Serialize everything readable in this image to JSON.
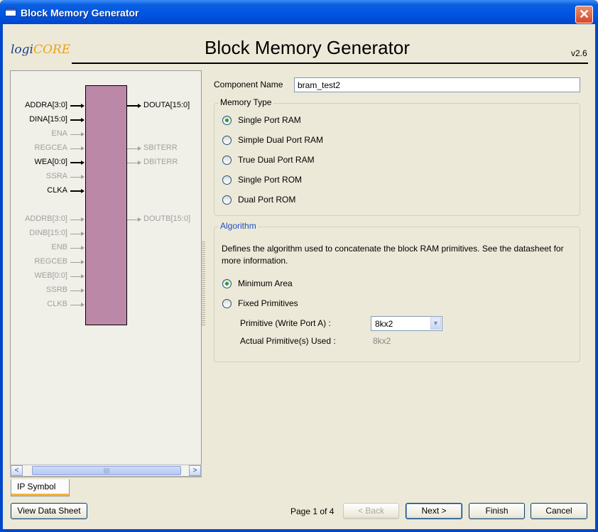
{
  "window": {
    "title": "Block Memory Generator",
    "close_symbol": "✕"
  },
  "header": {
    "logo_main": "logi",
    "logo_accent": "CORE",
    "title": "Block Memory Generator",
    "version": "v2.6"
  },
  "symbol": {
    "pins_left": [
      {
        "label": "ADDRA[3:0]",
        "active": true
      },
      {
        "label": "DINA[15:0]",
        "active": true
      },
      {
        "label": "ENA",
        "active": false
      },
      {
        "label": "REGCEA",
        "active": false
      },
      {
        "label": "WEA[0:0]",
        "active": true
      },
      {
        "label": "SSRA",
        "active": false
      },
      {
        "label": "CLKA",
        "active": true
      },
      {
        "label": "ADDRB[3:0]",
        "active": false
      },
      {
        "label": "DINB[15:0]",
        "active": false
      },
      {
        "label": "ENB",
        "active": false
      },
      {
        "label": "REGCEB",
        "active": false
      },
      {
        "label": "WEB[0:0]",
        "active": false
      },
      {
        "label": "SSRB",
        "active": false
      },
      {
        "label": "CLKB",
        "active": false
      }
    ],
    "pins_right": [
      {
        "label": "DOUTA[15:0]",
        "active": true
      },
      {
        "label": "SBITERR",
        "active": false
      },
      {
        "label": "DBITERR",
        "active": false
      },
      {
        "label": "DOUTB[15:0]",
        "active": false
      }
    ],
    "tab_label": "IP Symbol",
    "scroll_left": "<",
    "scroll_right": ">",
    "scroll_grip": "||||"
  },
  "component": {
    "label": "Component Name",
    "value": "bram_test2"
  },
  "memory_type": {
    "label": "Memory Type",
    "options": [
      "Single Port RAM",
      "Simple Dual Port RAM",
      "True Dual Port RAM",
      "Single Port ROM",
      "Dual Port ROM"
    ],
    "selected": 0
  },
  "algorithm": {
    "label": "Algorithm",
    "description": "Defines the algorithm used to concatenate the block RAM primitives.  See the datasheet for more information.",
    "options": [
      "Minimum Area",
      "Fixed Primitives"
    ],
    "selected": 0,
    "primitive_label": "Primitive (Write Port A) :",
    "primitive_value": "8kx2",
    "actual_label": "Actual Primitive(s) Used :",
    "actual_value": "8kx2"
  },
  "footer": {
    "view_datasheet": "View Data Sheet",
    "page_indicator": "Page 1 of 4",
    "back": "< Back",
    "next": "Next >",
    "finish": "Finish",
    "cancel": "Cancel"
  },
  "colors": {
    "block_fill": "#bb88a8",
    "titlebar": "#0054e3",
    "label_accent": "#1f4ec2"
  }
}
